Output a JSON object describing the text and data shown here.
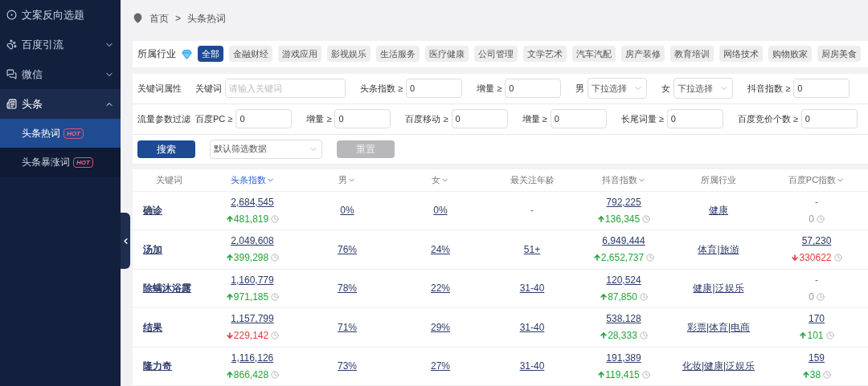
{
  "sidebar": {
    "items": [
      {
        "label": "文案反向选题",
        "kind": "link"
      },
      {
        "label": "百度引流",
        "kind": "group",
        "expanded": false
      },
      {
        "label": "微信",
        "kind": "group",
        "expanded": false
      },
      {
        "label": "头条",
        "kind": "group",
        "expanded": true,
        "children": [
          {
            "label": "头条热词",
            "badge": "HOT",
            "selected": true
          },
          {
            "label": "头条暴涨词",
            "badge": "HOT",
            "selected": false
          }
        ]
      }
    ]
  },
  "breadcrumb": [
    "首页",
    ">",
    "头条热词"
  ],
  "industry": {
    "label": "所属行业",
    "items": [
      {
        "label": "全部",
        "selected": true
      },
      {
        "label": "金融财经",
        "selected": false
      },
      {
        "label": "游戏应用",
        "selected": false
      },
      {
        "label": "影视娱乐",
        "selected": false
      },
      {
        "label": "生活服务",
        "selected": false
      },
      {
        "label": "医疗健康",
        "selected": false
      },
      {
        "label": "公司管理",
        "selected": false
      },
      {
        "label": "文学艺术",
        "selected": false
      },
      {
        "label": "汽车汽配",
        "selected": false
      },
      {
        "label": "房产装修",
        "selected": false
      },
      {
        "label": "教育培训",
        "selected": false
      },
      {
        "label": "网络技术",
        "selected": false
      },
      {
        "label": "购物败家",
        "selected": false
      },
      {
        "label": "厨房美食",
        "selected": false
      }
    ]
  },
  "filters": [
    {
      "label": "关键词属性",
      "fields": [
        {
          "label": "关键词",
          "kind": "input",
          "placeholder": "请输入关键词"
        },
        {
          "label": "头条指数 ≥",
          "kind": "input",
          "value": "0"
        },
        {
          "label": "增量 ≥",
          "kind": "input",
          "value": "0"
        },
        {
          "label": "男",
          "kind": "select",
          "placeholder": "下拉选择"
        },
        {
          "label": "女",
          "kind": "select",
          "placeholder": "下拉选择"
        },
        {
          "label": "抖音指数 ≥",
          "kind": "input",
          "value": "0"
        }
      ]
    },
    {
      "label": "流量参数过滤",
      "fields": [
        {
          "label": "百度PC ≥",
          "kind": "input",
          "value": "0"
        },
        {
          "label": "增量 ≥",
          "kind": "input",
          "value": "0"
        },
        {
          "label": "百度移动 ≥",
          "kind": "input",
          "value": "0"
        },
        {
          "label": "增量 ≥",
          "kind": "input",
          "value": "0"
        },
        {
          "label": "长尾词量 ≥",
          "kind": "input",
          "value": "0"
        },
        {
          "label": "百度竞价个数 ≥",
          "kind": "input",
          "value": "0"
        }
      ]
    }
  ],
  "actions": {
    "search": "搜索",
    "preset": "默认筛选数据",
    "reset": "重置"
  },
  "table": {
    "columns": [
      {
        "label": "关键词",
        "sortable": false,
        "selected": false
      },
      {
        "label": "头条指数",
        "sortable": true,
        "selected": true
      },
      {
        "label": "男",
        "sortable": true,
        "selected": false
      },
      {
        "label": "女",
        "sortable": true,
        "selected": false
      },
      {
        "label": "最关注年龄",
        "sortable": false,
        "selected": false
      },
      {
        "label": "抖音指数",
        "sortable": true,
        "selected": false
      },
      {
        "label": "所属行业",
        "sortable": false,
        "selected": false
      },
      {
        "label": "百度PC指数",
        "sortable": true,
        "selected": false
      }
    ],
    "rows": [
      {
        "cells": [
          {
            "kind": "keyword",
            "text": "确诊"
          },
          {
            "kind": "metric",
            "value": "2,684,545",
            "linked": true,
            "delta": {
              "kind": "up",
              "text": "481,819"
            }
          },
          {
            "kind": "link",
            "text": "0%"
          },
          {
            "kind": "link",
            "text": "0%"
          },
          {
            "kind": "text",
            "text": "-"
          },
          {
            "kind": "metric",
            "value": "792,225",
            "linked": true,
            "delta": {
              "kind": "up",
              "text": "136,345"
            }
          },
          {
            "kind": "link",
            "text": "健康"
          },
          {
            "kind": "metric",
            "value": "-",
            "linked": false,
            "delta": {
              "kind": "none",
              "text": "0"
            }
          }
        ]
      },
      {
        "cells": [
          {
            "kind": "keyword",
            "text": "汤加"
          },
          {
            "kind": "metric",
            "value": "2,049,608",
            "linked": true,
            "delta": {
              "kind": "up",
              "text": "399,298"
            }
          },
          {
            "kind": "link",
            "text": "76%"
          },
          {
            "kind": "link",
            "text": "24%"
          },
          {
            "kind": "link",
            "text": "51+"
          },
          {
            "kind": "metric",
            "value": "6,949,444",
            "linked": true,
            "delta": {
              "kind": "up",
              "text": "2,652,737"
            }
          },
          {
            "kind": "link",
            "text": "体育|旅游"
          },
          {
            "kind": "metric",
            "value": "57,230",
            "linked": true,
            "delta": {
              "kind": "down",
              "text": "330622"
            }
          }
        ]
      },
      {
        "cells": [
          {
            "kind": "keyword",
            "text": "除螨沐浴露"
          },
          {
            "kind": "metric",
            "value": "1,160,779",
            "linked": true,
            "delta": {
              "kind": "up",
              "text": "971,185"
            }
          },
          {
            "kind": "link",
            "text": "78%"
          },
          {
            "kind": "link",
            "text": "22%"
          },
          {
            "kind": "link",
            "text": "31-40"
          },
          {
            "kind": "metric",
            "value": "120,524",
            "linked": true,
            "delta": {
              "kind": "up",
              "text": "87,850"
            }
          },
          {
            "kind": "link",
            "text": "健康|泛娱乐"
          },
          {
            "kind": "metric",
            "value": "-",
            "linked": false,
            "delta": {
              "kind": "none",
              "text": "0"
            }
          }
        ]
      },
      {
        "cells": [
          {
            "kind": "keyword",
            "text": "结果"
          },
          {
            "kind": "metric",
            "value": "1,157,799",
            "linked": true,
            "delta": {
              "kind": "down",
              "text": "229,142"
            }
          },
          {
            "kind": "link",
            "text": "71%"
          },
          {
            "kind": "link",
            "text": "29%"
          },
          {
            "kind": "link",
            "text": "31-40"
          },
          {
            "kind": "metric",
            "value": "538,128",
            "linked": true,
            "delta": {
              "kind": "up",
              "text": "28,333"
            }
          },
          {
            "kind": "link",
            "text": "彩票|体育|电商"
          },
          {
            "kind": "metric",
            "value": "170",
            "linked": true,
            "delta": {
              "kind": "up",
              "text": "101"
            }
          }
        ]
      },
      {
        "cells": [
          {
            "kind": "keyword",
            "text": "隆力奇"
          },
          {
            "kind": "metric",
            "value": "1,116,126",
            "linked": true,
            "delta": {
              "kind": "up",
              "text": "866,428"
            }
          },
          {
            "kind": "link",
            "text": "73%"
          },
          {
            "kind": "link",
            "text": "27%"
          },
          {
            "kind": "link",
            "text": "31-40"
          },
          {
            "kind": "metric",
            "value": "191,389",
            "linked": true,
            "delta": {
              "kind": "up",
              "text": "119,415"
            }
          },
          {
            "kind": "link",
            "text": "化妆|健康|泛娱乐"
          },
          {
            "kind": "metric",
            "value": "159",
            "linked": true,
            "delta": {
              "kind": "up",
              "text": "38"
            }
          }
        ]
      }
    ]
  }
}
